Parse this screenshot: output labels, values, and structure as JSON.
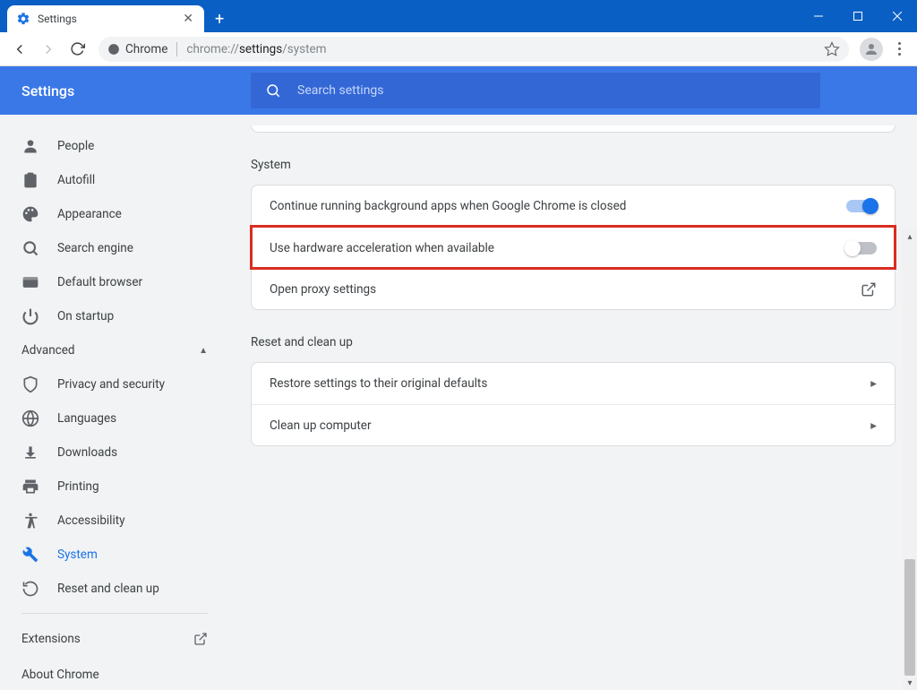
{
  "window": {
    "tab_title": "Settings",
    "chrome_chip": "Chrome",
    "url_dim1": "chrome://",
    "url_strong": "settings",
    "url_dim2": "/system"
  },
  "header": {
    "settings_title": "Settings",
    "search_placeholder": "Search settings"
  },
  "sidebar": {
    "items": [
      {
        "icon": "person",
        "label": "People"
      },
      {
        "icon": "clipboard",
        "label": "Autofill"
      },
      {
        "icon": "palette",
        "label": "Appearance"
      },
      {
        "icon": "search",
        "label": "Search engine"
      },
      {
        "icon": "browser",
        "label": "Default browser"
      },
      {
        "icon": "power",
        "label": "On startup"
      }
    ],
    "advanced_label": "Advanced",
    "adv_items": [
      {
        "icon": "shield",
        "label": "Privacy and security"
      },
      {
        "icon": "globe",
        "label": "Languages"
      },
      {
        "icon": "download",
        "label": "Downloads"
      },
      {
        "icon": "printer",
        "label": "Printing"
      },
      {
        "icon": "accessibility",
        "label": "Accessibility"
      },
      {
        "icon": "wrench",
        "label": "System",
        "active": true
      },
      {
        "icon": "restore",
        "label": "Reset and clean up"
      }
    ],
    "extensions_label": "Extensions",
    "about_label": "About Chrome"
  },
  "content": {
    "system_title": "System",
    "system_rows": [
      {
        "label": "Continue running background apps when Google Chrome is closed",
        "control": "toggle",
        "value": true
      },
      {
        "label": "Use hardware acceleration when available",
        "control": "toggle",
        "value": false,
        "highlight": true
      },
      {
        "label": "Open proxy settings",
        "control": "openext"
      }
    ],
    "reset_title": "Reset and clean up",
    "reset_rows": [
      {
        "label": "Restore settings to their original defaults",
        "control": "chevron"
      },
      {
        "label": "Clean up computer",
        "control": "chevron"
      }
    ]
  }
}
